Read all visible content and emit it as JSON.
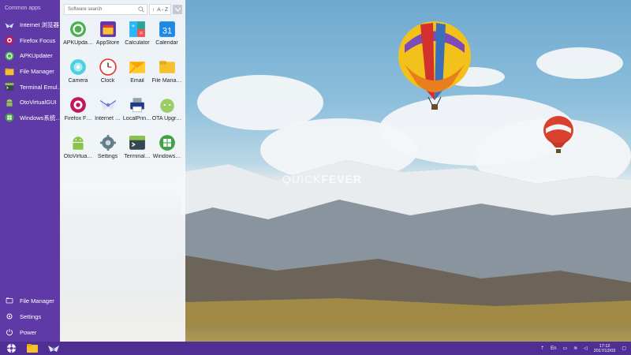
{
  "wallpaper": {
    "watermark_light": "QUICK",
    "watermark_bold": "FEVER"
  },
  "sidebar": {
    "heading": "Common apps",
    "apps": [
      {
        "label": "Internet 浏览器",
        "icon": "internet-browser-icon"
      },
      {
        "label": "Firefox Focus",
        "icon": "firefox-focus-icon"
      },
      {
        "label": "APKUpdater",
        "icon": "apkupdater-icon"
      },
      {
        "label": "File Manager",
        "icon": "folder-icon"
      },
      {
        "label": "Terminal Emul…",
        "icon": "terminal-icon"
      },
      {
        "label": "OtoVirtualGUI",
        "icon": "android-icon"
      },
      {
        "label": "Windows系统…",
        "icon": "windows-icon"
      }
    ],
    "bottom": [
      {
        "label": "File Manager",
        "icon": "folder-outline-icon"
      },
      {
        "label": "Settings",
        "icon": "gear-icon"
      },
      {
        "label": "Power",
        "icon": "power-icon"
      }
    ]
  },
  "drawer": {
    "search_placeholder": "Software search",
    "sort_label": "A - Z",
    "apps": [
      {
        "label": "APKUpda…",
        "icon": "apkupdater-icon"
      },
      {
        "label": "AppStore",
        "icon": "appstore-icon"
      },
      {
        "label": "Calculator",
        "icon": "calculator-icon"
      },
      {
        "label": "Calendar",
        "icon": "calendar-icon",
        "text": "31"
      },
      {
        "label": "Camera",
        "icon": "camera-icon"
      },
      {
        "label": "Clock",
        "icon": "clock-icon"
      },
      {
        "label": "Email",
        "icon": "email-icon"
      },
      {
        "label": "File Mana…",
        "icon": "folder-icon"
      },
      {
        "label": "Firefox F…",
        "icon": "firefox-focus-icon"
      },
      {
        "label": "Internet …",
        "icon": "internet-browser-icon"
      },
      {
        "label": "LocalPrin…",
        "icon": "printer-icon"
      },
      {
        "label": "OTA Upgr…",
        "icon": "ota-upgrade-icon"
      },
      {
        "label": "OtoVirtua…",
        "icon": "android-icon"
      },
      {
        "label": "Settings",
        "icon": "gear-icon"
      },
      {
        "label": "Terminal…",
        "icon": "terminal-icon"
      },
      {
        "label": "Windows…",
        "icon": "windows-icon"
      }
    ]
  },
  "taskbar": {
    "language": "En",
    "time": "17:12",
    "date": "2017/12/03"
  },
  "colors": {
    "sidebar": "#5f3aa7",
    "taskbar": "#4f2f94",
    "drawer": "#f5f7fa"
  }
}
